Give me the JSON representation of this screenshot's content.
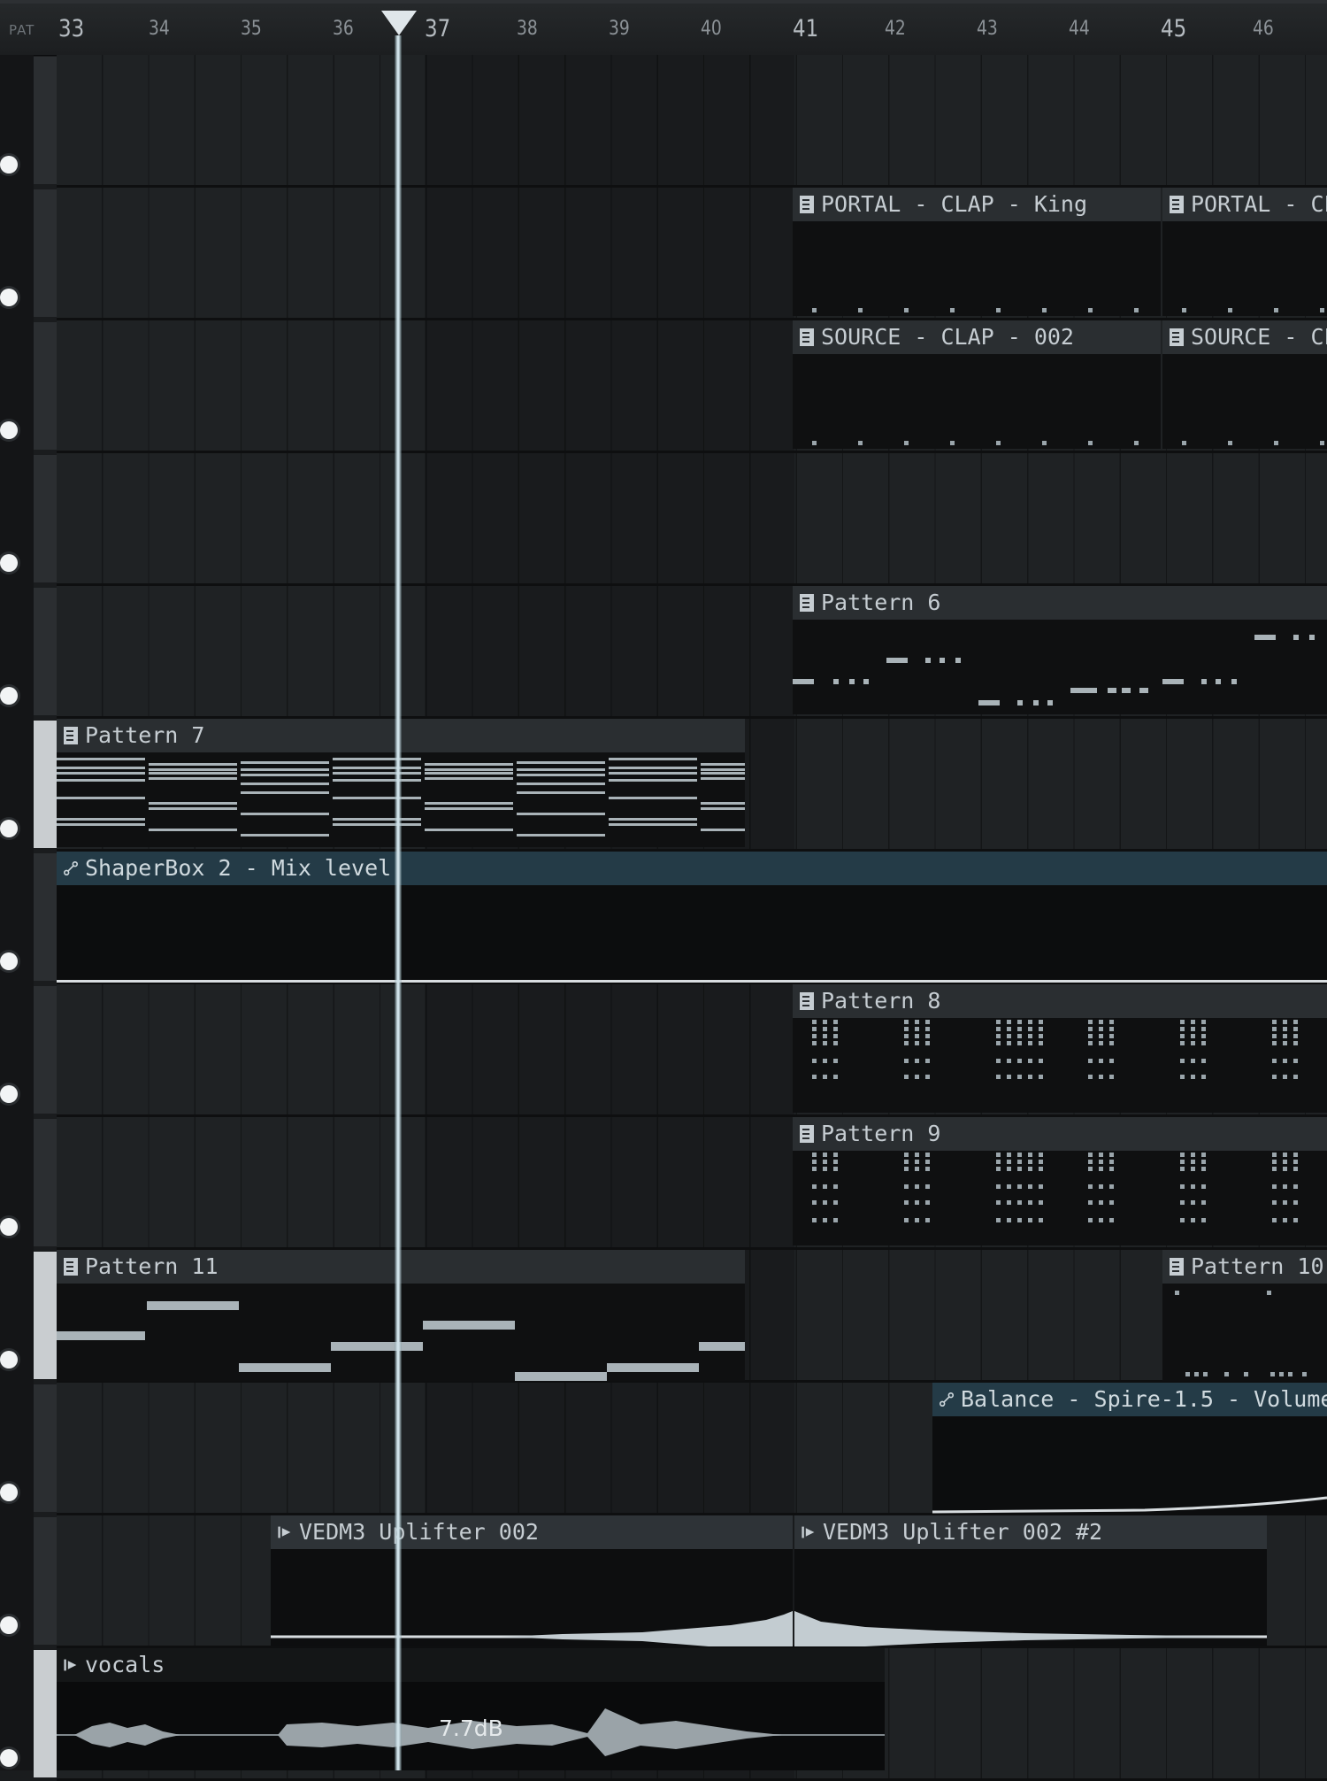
{
  "ruler": {
    "pat_label": "PAT",
    "bars": [
      "33",
      "34",
      "35",
      "36",
      "37",
      "38",
      "39",
      "40",
      "41",
      "42",
      "43",
      "44",
      "45",
      "46"
    ]
  },
  "clips": {
    "portal_clap_1": "PORTAL - CLAP - King",
    "portal_clap_2": "PORTAL - CL",
    "source_clap_1": "SOURCE - CLAP - 002",
    "source_clap_2": "SOURCE - CL",
    "pattern6": "Pattern 6",
    "pattern7": "Pattern 7",
    "automation_shaperbox": "ShaperBox 2 - Mix level",
    "pattern8": "Pattern 8",
    "pattern9": "Pattern 9",
    "pattern11": "Pattern 11",
    "pattern10": "Pattern 10",
    "automation_balance": "Balance - Spire-1.5 - Volume",
    "uplifter1": "VEDM3 Uplifter 002",
    "uplifter2": "VEDM3 Uplifter 002 #2",
    "vocals": "vocals",
    "vocals_gain": "7.7dB"
  },
  "colors": {
    "accent_automation": "#243b47",
    "playhead": "#cfe1e8"
  },
  "icons": [
    "pattern-icon",
    "automation-icon",
    "audio-clip-icon",
    "playhead-marker-icon"
  ]
}
